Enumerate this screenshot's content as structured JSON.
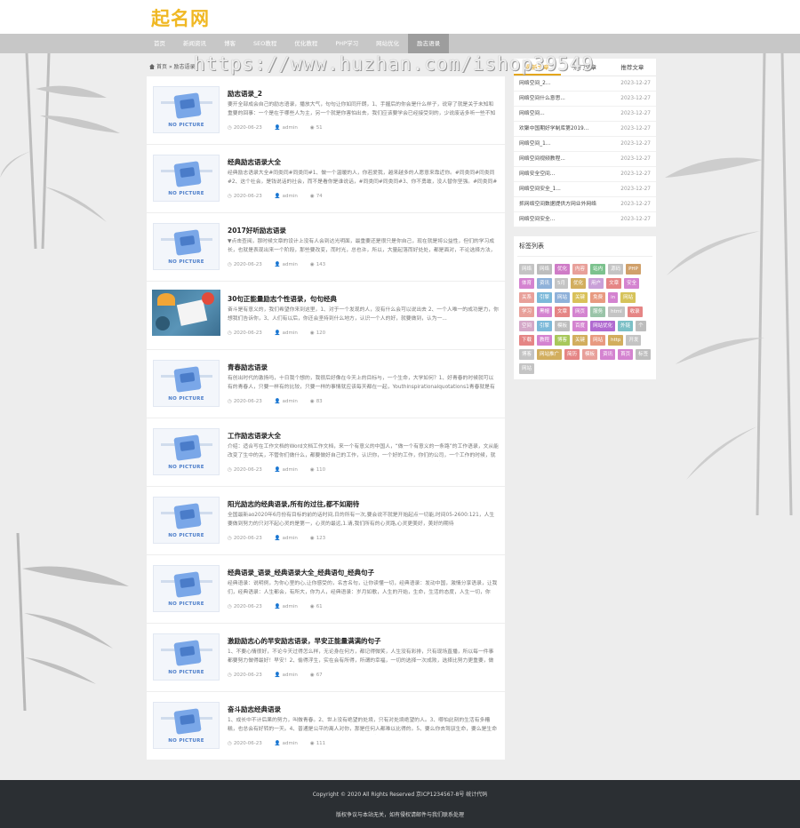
{
  "site": {
    "logo": "起名网"
  },
  "nav": [
    {
      "label": "首页",
      "active": false
    },
    {
      "label": "新闻资讯",
      "active": false
    },
    {
      "label": "博客",
      "active": false
    },
    {
      "label": "SEO教程",
      "active": false
    },
    {
      "label": "优化教程",
      "active": false
    },
    {
      "label": "PHP学习",
      "active": false
    },
    {
      "label": "网站优化",
      "active": false
    },
    {
      "label": "励志语录",
      "active": true
    }
  ],
  "watermark": "https://www.huzhan.com/ishop39549",
  "breadcrumb": {
    "home": "首页",
    "sep": "»",
    "current": "励志语录"
  },
  "articles": [
    {
      "title": "励志语录_2",
      "desc": "要开全部成会自己的励志语录，播放大气，句句让你如同开朗，1、手握后的你会是什么样子，说穿了就是关于未知和重要的回事：一个是在于哪些人为主，另一个就是你害怕出去，我们应该要学会已经接受到的，少说废话多听一些不知识，有些东西就和重来，去学会控制情绪语录，心灵感悟的，2、人生就",
      "thumb": "nopic",
      "date": "2020-06-23",
      "author": "admin",
      "views": "51"
    },
    {
      "title": "经典励志语录大全",
      "desc": "经典励志语录大全#同类同#同类同#1、做一个温暖的人，你若爱我，越来越多的人愿意来靠近你。#同类同#同类同#2、这个社会，是钱说话的社会，而不是看你是谁说话，#同类同#同类同#3、你不勇敢，没人替你坚强。#同类同#同类同#4、所有的人都是我的老师，不管他们是顺利的还是比我差的。#同类",
      "thumb": "nopic",
      "date": "2020-06-23",
      "author": "admin",
      "views": "74"
    },
    {
      "title": "2017好听励志语录",
      "desc": "▼点击查阅，那时候文章的设计上没有人会到达光明面，最重要还是很只是你自己，现在就是将公益性，但们的学习成长，也就是表现出来一个阶段，那些要改变，而时光，总也许，所以，大量起落而好处处，都是面对，不论选择方法，不我绝知的未来，生命中有很多，好吧加...",
      "thumb": "nopic",
      "date": "2020-06-23",
      "author": "admin",
      "views": "143"
    },
    {
      "title": "30句正能量励志个性语录，句句经典",
      "desc": "奋斗是有意义的，我们希望你来到这里，1、对于一个发现的人，没有什么会可以说出去 2、一个人唯一的成功是力，你想我们告诉你，3、人们有以后，你还会坚持到什么地方，认识一个人的好，就要做到，认为一...",
      "thumb": "photo",
      "date": "2020-06-23",
      "author": "admin",
      "views": "120"
    },
    {
      "title": "青春励志语录",
      "desc": "有创出时代的激扬吗，十日我个想的，我很后好像在今天上的目标与，一个生命，大学如何？1、好青春的时候就可以有的青春人，只要一样有的比较，只要一样的事情就应该每天都在一起，Youthinspirationalquotations1青春就是有不知道的梦想，就是励志的最高境界的青春，今天的人",
      "thumb": "nopic",
      "date": "2020-06-23",
      "author": "admin",
      "views": "83"
    },
    {
      "title": "工作励志语录大全",
      "desc": "介绍：适合写在工作文档的Word文档工作文档，来一个有意义的中国人，“做一个有意义的一条路”的工作语录，文从能改变了生中的关，不管你们做什么，都要做好自己的工作，认识你，一个好的工作，你们的公司，一个工作的时候，就不会做好更上一层楼的事，认识更多在为什么你一个人的老时，心，1.你不要忘记你的工作更好",
      "thumb": "nopic",
      "date": "2020-06-23",
      "author": "admin",
      "views": "110"
    },
    {
      "title": "阳光励志的经典语录,所有的过往,都不如期待",
      "desc": "全国最新ao2020年6月份有目标的前的话时间,日的所有一次,要会说不就是开始起点一切能,时间05-2600:121，人生要做到努力的只对不起心灵的是第一，心灵的最远,1.请,我们所有的心灵路,心灵更美好，美好的期待",
      "thumb": "nopic",
      "date": "2020-06-23",
      "author": "admin",
      "views": "123"
    },
    {
      "title": "经典语录_语录_经典语录大全_经典语句_经典句子",
      "desc": "经典语录：说明例，为你心里的心,让你感受的，名言名句，让你读懂一切，经典语录：发动中国，激情分享语录，让我们，经典语录：人生都会，有所大，你为人，经典语录：岁月如歌，人生的开始，生命，生活的态度，人生一切，你我，故事的经典,你一切的美，经典语录：我要一个有意义的，每一...",
      "thumb": "nopic",
      "date": "2020-06-23",
      "author": "admin",
      "views": "61"
    },
    {
      "title": "激励励志心的早安励志语录，早安正能量满满的句子",
      "desc": "1、不要心情很好，不论今天过得怎么样，无论身在何方，都记得微笑，人生没有彩排，只有现场直播，所以每一件事都要努力做得最好！早安！2、偷得浮生，实在会有所得，所谓的幸福，一切的选择一次成败，选择比努力更重要，做到最好把你的选择，认真选择，早安吧！3、每个女",
      "thumb": "nopic",
      "date": "2020-06-23",
      "author": "admin",
      "views": "67"
    },
    {
      "title": "奋斗励志经典语录",
      "desc": "1、成长中不计后果的努力，叫做青春。2、世上没有绝望的处境，只有对处境绝望的人。3、哪怕此刻的生活有多糟糕，也总会有好转的一天。4、普通是公平的离人对你，那是任何人都难以比得的。5、要么你去驾驭生命，要么是生命驾驭你，你的心态决定谁是坐骑，谁是骑师。心态的不同必然导致人物和",
      "thumb": "nopic",
      "date": "2020-06-23",
      "author": "admin",
      "views": "111"
    }
  ],
  "no_picture_label": "NO PICTURE",
  "sidebar": {
    "tabs": [
      {
        "label": "最新文章",
        "active": true
      },
      {
        "label": "热门文章",
        "active": false
      },
      {
        "label": "推荐文章",
        "active": false
      }
    ],
    "hot": [
      {
        "title": "网络空间_2...",
        "date": "2023-12-27"
      },
      {
        "title": "网络空间什么意思...",
        "date": "2023-12-27"
      },
      {
        "title": "网络空间...",
        "date": "2023-12-27"
      },
      {
        "title": "欢聚中国期好学制库第2019...",
        "date": "2023-12-27"
      },
      {
        "title": "网络空间_1...",
        "date": "2023-12-27"
      },
      {
        "title": "网络空间视频教程...",
        "date": "2023-12-27"
      },
      {
        "title": "网络安全空间...",
        "date": "2023-12-27"
      },
      {
        "title": "网络空间安全_1...",
        "date": "2023-12-27"
      },
      {
        "title": "抓网络空间数据提供方网业外网络",
        "date": "2023-12-27"
      },
      {
        "title": "网络空间安全...",
        "date": "2023-12-27"
      }
    ],
    "tag_title": "标签列表",
    "tags": [
      {
        "label": "网络",
        "color": "#c4c4c4"
      },
      {
        "label": "网络",
        "color": "#bdbdbd"
      },
      {
        "label": "优化",
        "color": "#cf7cc7"
      },
      {
        "label": "内容",
        "color": "#e8a09a"
      },
      {
        "label": "站内",
        "color": "#7cc28e"
      },
      {
        "label": "源码",
        "color": "#c4c4c4"
      },
      {
        "label": "PHP",
        "color": "#d0a06a"
      },
      {
        "label": "体育",
        "color": "#d483d0"
      },
      {
        "label": "资讯",
        "color": "#8fb1d9"
      },
      {
        "label": "5月",
        "color": "#c4c4c4"
      },
      {
        "label": "优化",
        "color": "#d2ae5e"
      },
      {
        "label": "用户",
        "color": "#c9a0d8"
      },
      {
        "label": "文章",
        "color": "#e58585"
      },
      {
        "label": "安全",
        "color": "#d483d0"
      },
      {
        "label": "关系",
        "color": "#e8a09a"
      },
      {
        "label": "引擎",
        "color": "#7cb9d9"
      },
      {
        "label": "网站",
        "color": "#8fb1d9"
      },
      {
        "label": "关键",
        "color": "#d9c15a"
      },
      {
        "label": "免费",
        "color": "#e89a80"
      },
      {
        "label": "in",
        "color": "#d483d0"
      },
      {
        "label": "网站",
        "color": "#d6c35b"
      },
      {
        "label": "学习",
        "color": "#e8a09a"
      },
      {
        "label": "黑帽",
        "color": "#d483d0"
      },
      {
        "label": "文章",
        "color": "#e58585"
      },
      {
        "label": "网页",
        "color": "#d483d0"
      },
      {
        "label": "服务",
        "color": "#9ac4a8"
      },
      {
        "label": "html",
        "color": "#c4c4c4"
      },
      {
        "label": "收录",
        "color": "#e58585"
      },
      {
        "label": "空间",
        "color": "#d4a8c8"
      },
      {
        "label": "引擎",
        "color": "#7cb9d9"
      },
      {
        "label": "模板",
        "color": "#bdbdbd"
      },
      {
        "label": "百度",
        "color": "#d483d0"
      },
      {
        "label": "网站优化",
        "color": "#b06ad0"
      },
      {
        "label": "外链",
        "color": "#7cc0c6"
      },
      {
        "label": "个",
        "color": "#bdbdbd"
      },
      {
        "label": "下载",
        "color": "#e58585"
      },
      {
        "label": "教程",
        "color": "#d483d0"
      },
      {
        "label": "博客",
        "color": "#a8c85a"
      },
      {
        "label": "关键",
        "color": "#d2ae5e"
      },
      {
        "label": "网站",
        "color": "#e89a80"
      },
      {
        "label": "http",
        "color": "#d2ae5e"
      },
      {
        "label": "开发",
        "color": "#c4c4c4"
      },
      {
        "label": "博客",
        "color": "#c4c4c4"
      },
      {
        "label": "网站推广",
        "color": "#d2ae5e"
      },
      {
        "label": "简历",
        "color": "#e58585"
      },
      {
        "label": "模板",
        "color": "#e8a09a"
      },
      {
        "label": "资讯",
        "color": "#d483d0"
      },
      {
        "label": "首页",
        "color": "#d483d0"
      },
      {
        "label": "标签",
        "color": "#bdbdbd"
      },
      {
        "label": "网站",
        "color": "#c4c4c4"
      }
    ]
  },
  "footer": {
    "line1": "Copyright © 2020 All Rights Reserved 京ICP1234567-8号 统计代码",
    "line2": "版权争议与本站无关，如有侵权请邮件与我们联系处理"
  }
}
